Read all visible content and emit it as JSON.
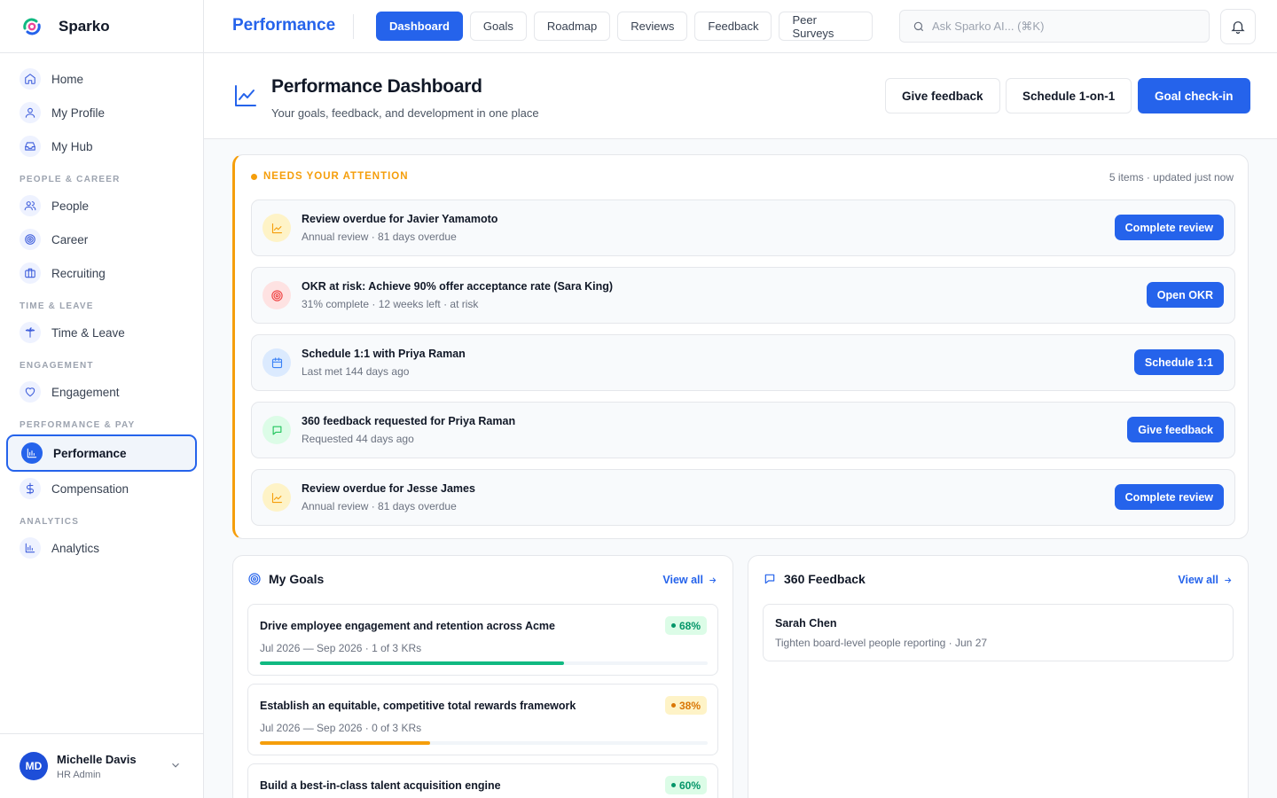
{
  "brand": {
    "name": "Sparko"
  },
  "sidebar": {
    "items": [
      {
        "label": "Home",
        "icon": "home-icon"
      },
      {
        "label": "My Profile",
        "icon": "user-icon"
      },
      {
        "label": "My Hub",
        "icon": "inbox-icon"
      },
      {
        "section": "PEOPLE & CAREER"
      },
      {
        "label": "People",
        "icon": "users-icon"
      },
      {
        "label": "Career",
        "icon": "target-icon"
      },
      {
        "label": "Recruiting",
        "icon": "briefcase-icon"
      },
      {
        "section": "TIME & LEAVE"
      },
      {
        "label": "Time & Leave",
        "icon": "palm-tree-icon"
      },
      {
        "section": "ENGAGEMENT"
      },
      {
        "label": "Engagement",
        "icon": "heart-icon"
      },
      {
        "section": "PERFORMANCE & PAY"
      },
      {
        "label": "Performance",
        "icon": "bar-chart-icon",
        "active": true
      },
      {
        "label": "Compensation",
        "icon": "dollar-icon"
      },
      {
        "section": "ANALYTICS"
      },
      {
        "label": "Analytics",
        "icon": "analytics-icon"
      }
    ],
    "user": {
      "initials": "MD",
      "name": "Michelle Davis",
      "role": "HR Admin"
    }
  },
  "topbar": {
    "title": "Performance",
    "tabs": [
      {
        "label": "Dashboard",
        "active": true
      },
      {
        "label": "Goals"
      },
      {
        "label": "Roadmap"
      },
      {
        "label": "Reviews"
      },
      {
        "label": "Feedback"
      },
      {
        "label": "Peer Surveys"
      }
    ],
    "search_placeholder": "Ask Sparko AI... (⌘K)"
  },
  "header": {
    "title": "Performance Dashboard",
    "subtitle": "Your goals, feedback, and development in one place",
    "buttons": {
      "give_feedback": "Give feedback",
      "schedule": "Schedule 1-on-1",
      "checkin": "Goal check-in"
    }
  },
  "attention": {
    "label": "NEEDS YOUR ATTENTION",
    "meta": "5 items · updated just now",
    "items": [
      {
        "title": "Review overdue for Javier Yamamoto",
        "desc": "Annual review · 81 days overdue",
        "action": "Complete review",
        "icon": "chart-icon",
        "tone": "amber"
      },
      {
        "title": "OKR at risk: Achieve 90% offer acceptance rate (Sara King)",
        "desc": "31% complete · 12 weeks left · at risk",
        "action": "Open OKR",
        "icon": "target-icon",
        "tone": "red"
      },
      {
        "title": "Schedule 1:1 with Priya Raman",
        "desc": "Last met 144 days ago",
        "action": "Schedule 1:1",
        "icon": "calendar-icon",
        "tone": "blue"
      },
      {
        "title": "360 feedback requested for Priya Raman",
        "desc": "Requested 44 days ago",
        "action": "Give feedback",
        "icon": "message-icon",
        "tone": "green"
      },
      {
        "title": "Review overdue for Jesse James",
        "desc": "Annual review · 81 days overdue",
        "action": "Complete review",
        "icon": "chart-icon",
        "tone": "amber"
      }
    ]
  },
  "goals": {
    "title": "My Goals",
    "view_all": "View all",
    "items": [
      {
        "title": "Drive employee engagement and retention across Acme",
        "meta": "Jul 2026 — Sep 2026 · 1 of 3 KRs",
        "badge": "68%",
        "progress": 0.68,
        "color": "#10b981",
        "badge_bg": "#dcfce7",
        "badge_fg": "#059669"
      },
      {
        "title": "Establish an equitable, competitive total rewards framework",
        "meta": "Jul 2026 — Sep 2026 · 0 of 3 KRs",
        "badge": "38%",
        "progress": 0.38,
        "color": "#f59e0b",
        "badge_bg": "#fef3c7",
        "badge_fg": "#d97706"
      },
      {
        "title": "Build a best-in-class talent acquisition engine",
        "meta": "",
        "badge": "60%",
        "progress": 0.6,
        "color": "#10b981",
        "badge_bg": "#dcfce7",
        "badge_fg": "#059669"
      }
    ]
  },
  "feedback": {
    "title": "360 Feedback",
    "view_all": "View all",
    "items": [
      {
        "name": "Sarah Chen",
        "desc": "Tighten board-level people reporting · Jun 27"
      }
    ]
  },
  "colors": {
    "accent": "#2563eb",
    "attention": "#f59e0b"
  }
}
